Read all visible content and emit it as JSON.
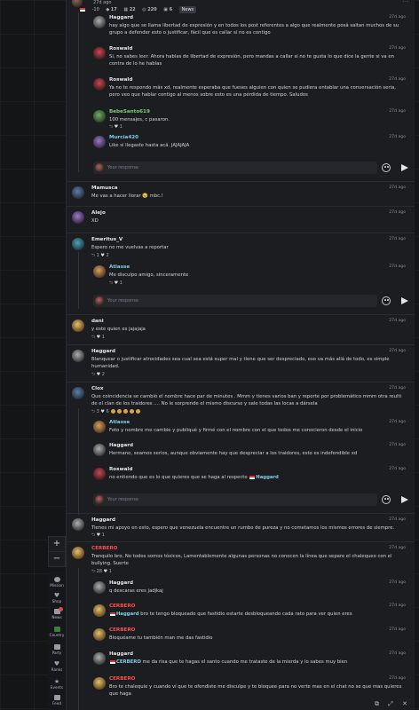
{
  "header": {
    "time": "27d ago",
    "stats": [
      "-10",
      "17",
      "22",
      "220",
      "6"
    ],
    "news_label": "News"
  },
  "comments": [
    {
      "id": "haggard1",
      "name": "Haggard",
      "time": "27d ago",
      "text": "hay algo que se llama libertad de expresión y en todos los post referentes a algo que realmente posá saltan muchos de su grupo a defender esto o justificar, fácil que es callar si no es contigo"
    },
    {
      "id": "roswald1",
      "name": "Roswald",
      "time": "27d ago",
      "text": "Si, no sabes leer. Ahora hablas de libertad de expresión, pero mandas a callar si no te gusta lo que dice la gente si va en contra de lo he hablas"
    },
    {
      "id": "roswald2",
      "name": "Roswald",
      "time": "27d ago",
      "text": "Ya no te respondo más xd, realmente esperaba que fueses alguien con quien se pudiera entablar una conversación seria, pero veo que hablar contigo al menos sobre esto es una pérdida de tiempo. Saludos"
    },
    {
      "id": "bebe",
      "name": "BebeSanto619",
      "time": "27d ago",
      "text": "100 mensajes, c pasaron.",
      "likes": "1"
    },
    {
      "id": "murcia",
      "name": "Murcia420",
      "time": "27d ago",
      "text": "Like si llegaste hasta acá. JAJAJAJA"
    },
    {
      "id": "mamusca",
      "name": "Mamusca",
      "time": "27d ago",
      "text": "Me vas a hacer llorar 🥹 mbc.!"
    },
    {
      "id": "alejo",
      "name": "Alejo",
      "time": "27d ago",
      "text": "XD"
    },
    {
      "id": "emeritus",
      "name": "Emeritus_V",
      "time": "27d ago",
      "text": "Espero no me vuelvas a reportar",
      "likes": "2",
      "replies": "1"
    },
    {
      "id": "atlasse1",
      "name": "Atlasse",
      "time": "27d ago",
      "text": "Me disculpo amigo, sinceramente",
      "likes": "1"
    },
    {
      "id": "dani",
      "name": "dani",
      "time": "27d ago",
      "text": "y este quien es jajajaja",
      "likes": "1"
    },
    {
      "id": "haggard2",
      "name": "Haggard",
      "time": "27d ago",
      "text": "Blanquear o justificar atrocidades sea cual sea está super mal y tiene que ser despreciado, eso va más allá de todo, es simple humanidad.",
      "likes": "2"
    },
    {
      "id": "clox",
      "name": "Clox",
      "time": "27d ago",
      "text": "Que coincidencia se cambió el nombre hace par de minutes . Mmm y tienes varios ban y reporte por problemático mmm otra reulti de el clan de los traidores .... No le sorprende el mismo discurso y sale todas las locas a dársela",
      "likes": "3",
      "replies": "6"
    },
    {
      "id": "atlasse2",
      "name": "Atlasse",
      "time": "27d ago",
      "text": "Foto y nombre me cambie y publiqué y firmé con el nombre con el que todos me conocieron desde el inicio"
    },
    {
      "id": "haggard3",
      "name": "Haggard",
      "time": "27d ago",
      "text": "Hermano, seamos serios, aunque obviamente hay que despreciar a los traidores, esto es indefendible xd"
    },
    {
      "id": "roswald3",
      "name": "Roswald",
      "time": "27d ago",
      "text": "no entiendo que es lo que quieres que se haga al respecto",
      "mention": "Haggard"
    },
    {
      "id": "haggard4",
      "name": "Haggard",
      "time": "27d ago",
      "text": "Tienes mi apoyo en esto, espero que venezuela encuentre un rumbo de pureza y no cometamos los mismos errores de siempre.",
      "likes": "1"
    },
    {
      "id": "cerbero1",
      "name": "CERBERO",
      "time": "27d ago",
      "text": "Tranquilo bro, No todos somos tóxicos, Lamentablemente algunas personas no conocen la línea que separe el chalequeo con el bullying. Suerte",
      "likes": "28",
      "replies": "1"
    },
    {
      "id": "haggard5",
      "name": "Haggard",
      "time": "27d ago",
      "text": "q descaras eres jadjkaj"
    },
    {
      "id": "cerbero2",
      "name": "CERBERO",
      "time": "27d ago",
      "mention": "Haggard",
      "text": "bro te tengo bloqueado que fastidio estarte desbloqueando cada rato para ver quien eres"
    },
    {
      "id": "cerbero3",
      "name": "CERBERO",
      "time": "27d ago",
      "text": "Bloquéame tu también man me das fastidio"
    },
    {
      "id": "haggard6",
      "name": "Haggard",
      "time": "27d ago",
      "mention": "CERBERO",
      "text": "me da risa que te hagas el santo cuando me trataste de la mierda y lo sabes muy bien"
    },
    {
      "id": "cerbero4",
      "name": "CERBERO",
      "time": "27d ago",
      "text": "Bro te chalequie y cuando ví que te ofendiste me disculpe y te bloquee para no verte mas en el chat no se que mas quieres que haga"
    }
  ],
  "response_placeholder": "Your response",
  "sidenav": {
    "items": [
      "Mission",
      "Shop",
      "News",
      "Country",
      "Party",
      "Ranks",
      "Events",
      "Feed"
    ]
  },
  "map_controls": {
    "zoom_in": "+",
    "zoom_out": "−"
  }
}
